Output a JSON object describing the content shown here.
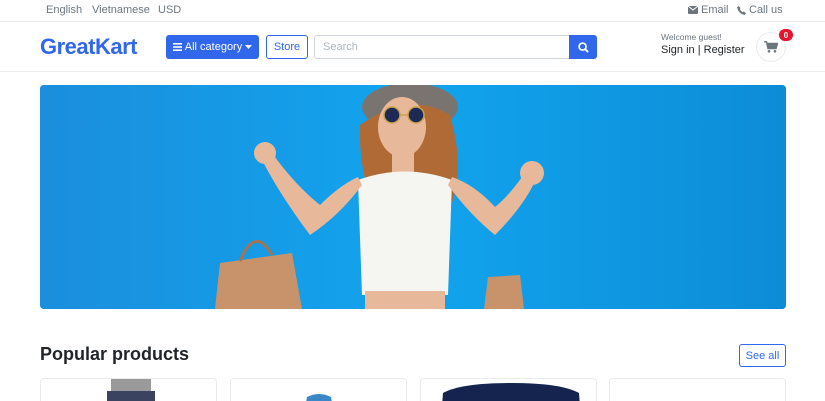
{
  "topbar": {
    "languages": [
      "English",
      "Vietnamese",
      "USD"
    ],
    "email_label": "Email",
    "call_label": "Call us"
  },
  "header": {
    "logo_part1": "Great",
    "logo_part2": "Kart",
    "category_label": "All category",
    "store_label": "Store",
    "search_placeholder": "Search",
    "welcome": "Welcome guest!",
    "sign_in": "Sign in",
    "register": "Register",
    "cart_count": "0"
  },
  "banner": {
    "alt": "hero banner"
  },
  "section": {
    "title": "Popular products",
    "see_all": "See all"
  },
  "colors": {
    "primary": "#3167eb",
    "badge": "#e3142c",
    "banner": "#13a3ec"
  },
  "icons": {
    "email": "envelope-icon",
    "phone": "phone-icon",
    "menu": "bars-icon",
    "caret": "caret-down-icon",
    "search": "search-icon",
    "cart": "shopping-cart-icon"
  }
}
